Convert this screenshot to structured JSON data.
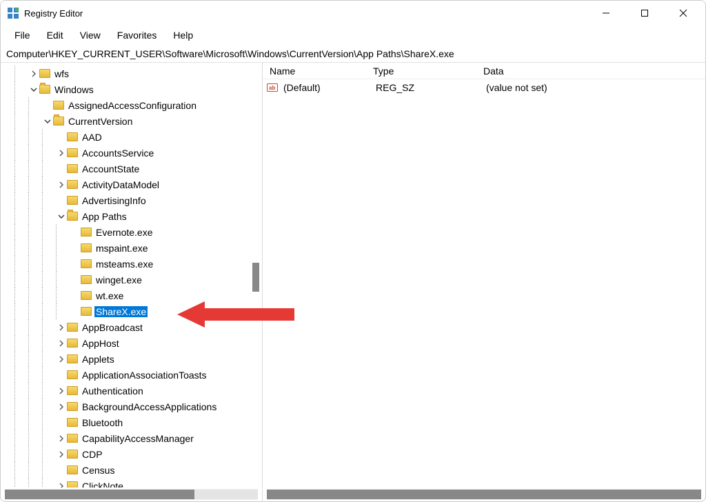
{
  "title": "Registry Editor",
  "menu": [
    "File",
    "Edit",
    "View",
    "Favorites",
    "Help"
  ],
  "address": "Computer\\HKEY_CURRENT_USER\\Software\\Microsoft\\Windows\\CurrentVersion\\App Paths\\ShareX.exe",
  "columns": {
    "name": "Name",
    "type": "Type",
    "data": "Data"
  },
  "value": {
    "name": "(Default)",
    "type": "REG_SZ",
    "data": "(value not set)"
  },
  "tree": [
    {
      "label": "wfs",
      "indent": 2,
      "caret": "closed"
    },
    {
      "label": "Windows",
      "indent": 2,
      "caret": "open"
    },
    {
      "label": "AssignedAccessConfiguration",
      "indent": 3,
      "caret": "none"
    },
    {
      "label": "CurrentVersion",
      "indent": 3,
      "caret": "open"
    },
    {
      "label": "AAD",
      "indent": 4,
      "caret": "none"
    },
    {
      "label": "AccountsService",
      "indent": 4,
      "caret": "closed"
    },
    {
      "label": "AccountState",
      "indent": 4,
      "caret": "none"
    },
    {
      "label": "ActivityDataModel",
      "indent": 4,
      "caret": "closed"
    },
    {
      "label": "AdvertisingInfo",
      "indent": 4,
      "caret": "none"
    },
    {
      "label": "App Paths",
      "indent": 4,
      "caret": "open"
    },
    {
      "label": "Evernote.exe",
      "indent": 5,
      "caret": "none"
    },
    {
      "label": "mspaint.exe",
      "indent": 5,
      "caret": "none"
    },
    {
      "label": "msteams.exe",
      "indent": 5,
      "caret": "none"
    },
    {
      "label": "winget.exe",
      "indent": 5,
      "caret": "none"
    },
    {
      "label": "wt.exe",
      "indent": 5,
      "caret": "none"
    },
    {
      "label": "ShareX.exe",
      "indent": 5,
      "caret": "none",
      "selected": true
    },
    {
      "label": "AppBroadcast",
      "indent": 4,
      "caret": "closed"
    },
    {
      "label": "AppHost",
      "indent": 4,
      "caret": "closed"
    },
    {
      "label": "Applets",
      "indent": 4,
      "caret": "closed"
    },
    {
      "label": "ApplicationAssociationToasts",
      "indent": 4,
      "caret": "none"
    },
    {
      "label": "Authentication",
      "indent": 4,
      "caret": "closed"
    },
    {
      "label": "BackgroundAccessApplications",
      "indent": 4,
      "caret": "closed"
    },
    {
      "label": "Bluetooth",
      "indent": 4,
      "caret": "none"
    },
    {
      "label": "CapabilityAccessManager",
      "indent": 4,
      "caret": "closed"
    },
    {
      "label": "CDP",
      "indent": 4,
      "caret": "closed"
    },
    {
      "label": "Census",
      "indent": 4,
      "caret": "none"
    },
    {
      "label": "ClickNote",
      "indent": 4,
      "caret": "closed"
    }
  ]
}
